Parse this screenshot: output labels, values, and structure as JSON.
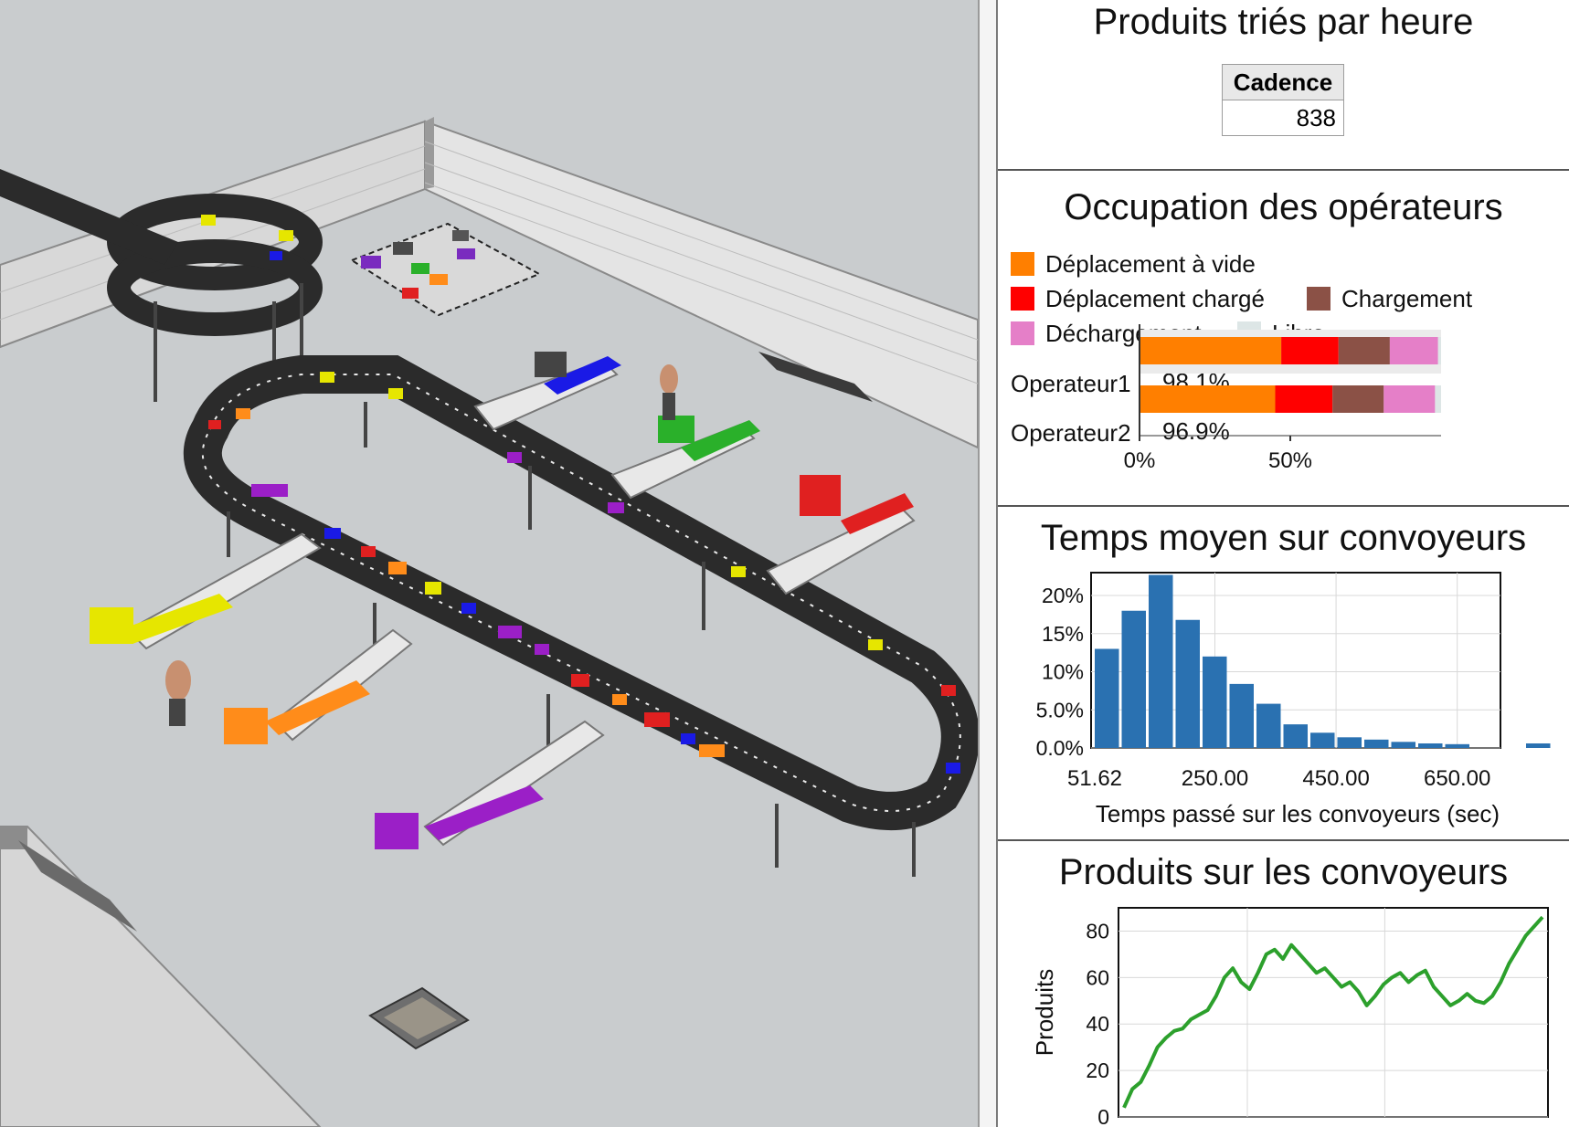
{
  "viewport": {
    "view_label": "3D conveyor sorting simulation"
  },
  "panels": {
    "throughput": {
      "title": "Produits triés par heure",
      "column_header": "Cadence",
      "value": "838"
    },
    "operators": {
      "title": "Occupation des opérateurs",
      "legend": [
        {
          "label": "Déplacement à vide",
          "color": "#ff7f00"
        },
        {
          "label": "Déplacement chargé",
          "color": "#ff0000"
        },
        {
          "label": "Chargement",
          "color": "#8b5146"
        },
        {
          "label": "Déchargement",
          "color": "#e57fc8"
        },
        {
          "label": "Libre",
          "color": "#dde6e6"
        }
      ],
      "rows": [
        {
          "name": "Operateur1",
          "percent": "98.1%"
        },
        {
          "name": "Operateur2",
          "percent": "96.9%"
        }
      ]
    },
    "conveyor_time": {
      "title": "Temps moyen sur convoyeurs"
    },
    "products_on_conveyors": {
      "title": "Produits sur les convoyeurs"
    }
  },
  "chart_data": [
    {
      "type": "bar",
      "orientation": "horizontal-stacked",
      "title": "Occupation des opérateurs",
      "categories": [
        "Operateur1",
        "Operateur2"
      ],
      "series": [
        {
          "name": "Déplacement à vide",
          "values": [
            47,
            45
          ]
        },
        {
          "name": "Déplacement chargé",
          "values": [
            19,
            19
          ]
        },
        {
          "name": "Chargement",
          "values": [
            17,
            17
          ]
        },
        {
          "name": "Déchargement",
          "values": [
            16,
            17
          ]
        },
        {
          "name": "Libre",
          "values": [
            1,
            2
          ]
        }
      ],
      "xticks": [
        "0%",
        "50%"
      ],
      "xlim": [
        0,
        100
      ],
      "grid": false
    },
    {
      "type": "bar",
      "title": "Temps moyen sur convoyeurs",
      "xlabel": "Temps passé sur les convoyeurs (sec)",
      "x_tick_labels": [
        "51.62",
        "250.00",
        "450.00",
        "650.00"
      ],
      "y_tick_labels": [
        "0.0%",
        "5.0%",
        "10%",
        "15%",
        "20%"
      ],
      "ylim": [
        0,
        23
      ],
      "bin_start": 51.62,
      "bin_width": 44.5,
      "values": [
        13.0,
        18.0,
        22.7,
        16.8,
        12.0,
        8.4,
        5.8,
        3.1,
        2.0,
        1.4,
        1.1,
        0.8,
        0.6,
        0.5,
        0,
        0,
        0.6
      ],
      "color": "#2a71b1",
      "grid": true
    },
    {
      "type": "line",
      "title": "Produits sur les convoyeurs",
      "ylabel": "Produits",
      "y_tick_labels": [
        "0",
        "20",
        "40",
        "60",
        "80"
      ],
      "ylim": [
        0,
        90
      ],
      "color": "#2ca02c",
      "x": [
        0,
        2,
        4,
        6,
        8,
        10,
        12,
        14,
        16,
        18,
        20,
        22,
        24,
        26,
        28,
        30,
        32,
        34,
        36,
        38,
        40,
        42,
        44,
        46,
        48,
        50,
        52,
        54,
        56,
        58,
        60,
        62,
        64,
        66,
        68,
        70,
        72,
        74,
        76,
        78,
        80,
        82,
        84,
        86,
        88,
        90,
        92,
        94,
        96,
        98,
        100
      ],
      "values": [
        4,
        12,
        15,
        22,
        30,
        34,
        37,
        38,
        42,
        44,
        46,
        52,
        60,
        64,
        58,
        55,
        62,
        70,
        72,
        68,
        74,
        70,
        66,
        62,
        64,
        60,
        56,
        58,
        54,
        48,
        52,
        57,
        60,
        62,
        58,
        61,
        63,
        56,
        52,
        48,
        50,
        53,
        50,
        49,
        52,
        58,
        66,
        72,
        78,
        82,
        86
      ],
      "grid": true
    }
  ]
}
